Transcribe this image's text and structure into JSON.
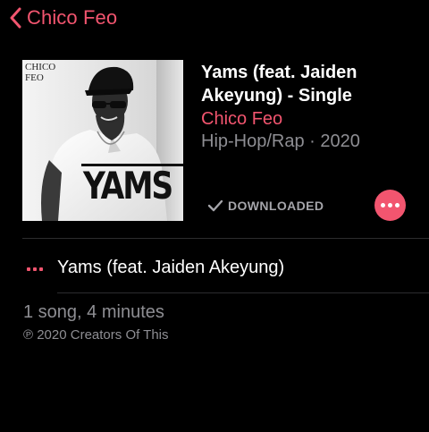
{
  "nav": {
    "back_label": "Chico Feo"
  },
  "album": {
    "art_credit": "CHICO\nFEO",
    "art_title": "YAMS",
    "title": "Yams (feat. Jaiden Akeyung) - Single",
    "artist": "Chico Feo",
    "genre_year": "Hip-Hop/Rap · 2020",
    "download_status": "DOWNLOADED"
  },
  "tracks": [
    {
      "title": "Yams (feat. Jaiden Akeyung)"
    }
  ],
  "footer": {
    "summary": "1 song, 4 minutes",
    "copyright": "℗ 2020 Creators Of This"
  },
  "colors": {
    "accent": "#f2556f",
    "background": "#000000",
    "secondary_text": "#8e8e93"
  },
  "icons": {
    "back": "chevron-left-icon",
    "downloaded": "checkmark-icon",
    "more": "ellipsis-icon",
    "now_playing": "now-playing-icon"
  }
}
